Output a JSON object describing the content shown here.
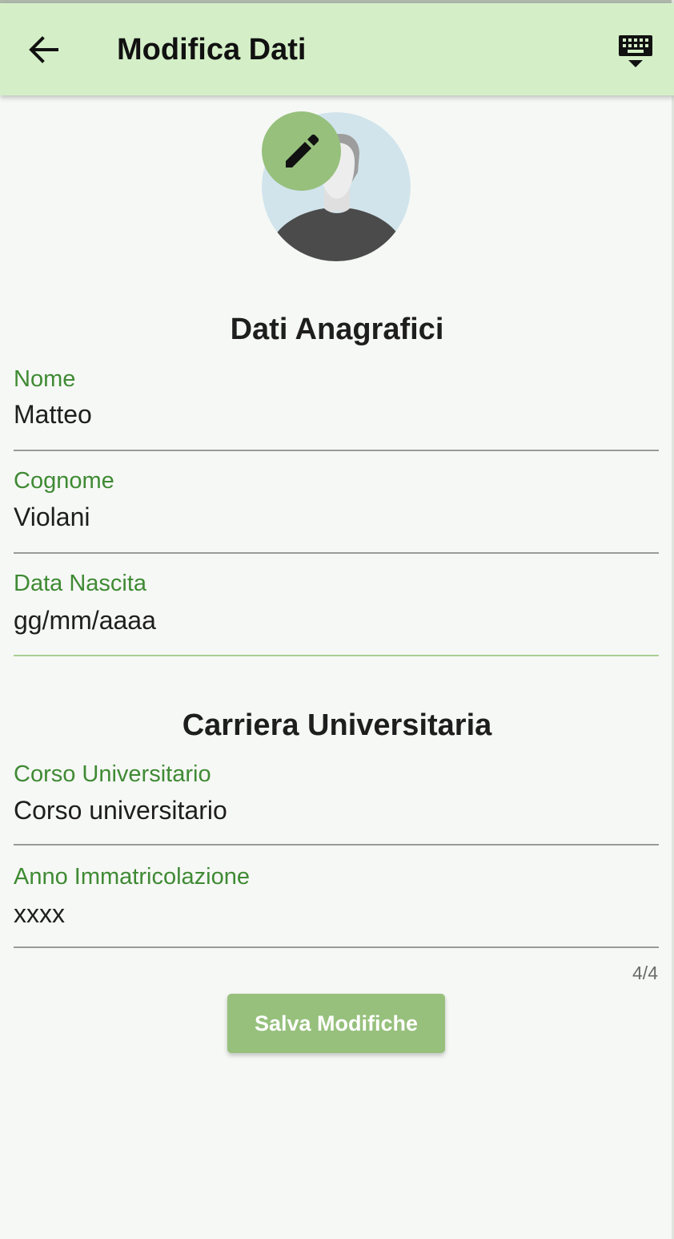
{
  "app_bar": {
    "title": "Modifica Dati",
    "back_icon": "arrow-left-icon",
    "keyboard_icon": "keyboard-hide-icon",
    "background": "#d4efc7"
  },
  "avatar": {
    "icon": "default-user-avatar",
    "edit_icon": "pencil-icon",
    "edit_button_color": "#96c07c"
  },
  "sections": {
    "personal": {
      "title": "Dati Anagrafici",
      "fields": [
        {
          "label": "Nome",
          "value": "Matteo"
        },
        {
          "label": "Cognome",
          "value": "Violani"
        },
        {
          "label": "Data Nascita",
          "value": "gg/mm/aaaa"
        }
      ]
    },
    "career": {
      "title": "Carriera Universitaria",
      "fields": [
        {
          "label": "Corso Universitario",
          "value": "Corso universitario"
        },
        {
          "label": "Anno Immatricolazione",
          "value": "xxxx"
        }
      ],
      "counter": "4/4"
    }
  },
  "save_button": {
    "label": "Salva Modifiche",
    "color": "#96c07c"
  },
  "colors": {
    "label_green": "#3f8a34",
    "background": "#f6f8f5"
  }
}
